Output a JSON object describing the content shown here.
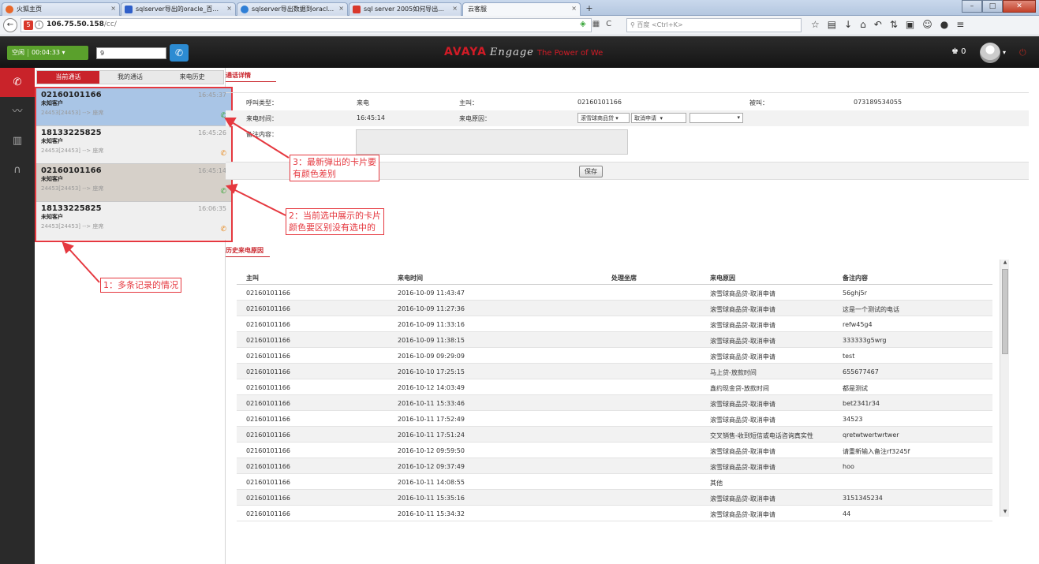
{
  "browser": {
    "tabs": [
      {
        "label": "火狐主页",
        "icon": "firefox-icon",
        "color": "#e8672a"
      },
      {
        "label": "sqlserver导出的oracle_百...",
        "icon": "baidu-paw-icon",
        "color": "#2f5fc9"
      },
      {
        "label": "sqlserver导出数据到oracl...",
        "icon": "baidu-search-icon",
        "color": "#2f7fd6"
      },
      {
        "label": "sql server 2005如何导出...",
        "icon": "document-icon",
        "color": "#d9382b"
      },
      {
        "label": "云客服",
        "icon": "",
        "color": ""
      }
    ],
    "new_tab": "+",
    "url_host": "106.75.50.158",
    "url_path": "/cc/",
    "search_placeholder": "百度 <Ctrl+K>"
  },
  "app": {
    "status_label": "空闲",
    "timer": "00:04:33",
    "dial_value": "9",
    "brand": "AVAYA",
    "brand_engage": "Engage",
    "brand_tagline": "The Power of We",
    "user_count": "0"
  },
  "call_tabs": [
    "当前通话",
    "我的通话",
    "来电历史"
  ],
  "cards": [
    {
      "number": "02160101166",
      "customer": "未知客户",
      "route": "24453[24453]  -->  座席",
      "time": "16:45:37",
      "icon_color": "#3aa63a"
    },
    {
      "number": "18133225825",
      "customer": "未知客户",
      "route": "24453[24453]  -->  座席",
      "time": "16:45:26",
      "icon_color": "#e8891d"
    },
    {
      "number": "02160101166",
      "customer": "未知客户",
      "route": "24453[24453]  -->  座席",
      "time": "16:45:14",
      "icon_color": "#3aa63a"
    },
    {
      "number": "18133225825",
      "customer": "未知客户",
      "route": "24453[24453]  -->  座席",
      "time": "16:06:35",
      "icon_color": "#e8891d"
    }
  ],
  "detail": {
    "title": "通话详情",
    "call_type_label": "呼叫类型：",
    "call_type_value": "来电",
    "caller_label": "主叫：",
    "caller_value": "02160101166",
    "callee_label": "被叫：",
    "callee_value": "073189534055",
    "time_label": "来电时间：",
    "time_value": "16:45:14",
    "reason_label": "来电原因：",
    "reason_select1": "滚雪球商品贷",
    "reason_select2": "取消申请",
    "reason_select3": "",
    "note_label": "备注内容：",
    "save_label": "保存"
  },
  "history": {
    "title": "历史来电原因",
    "columns": [
      "主叫",
      "来电时间",
      "处理坐席",
      "来电原因",
      "备注内容"
    ],
    "rows": [
      [
        "02160101166",
        "2016-10-09 11:43:47",
        "",
        "滚雪球商品贷-取消申请",
        "56ghj5r"
      ],
      [
        "02160101166",
        "2016-10-09 11:27:36",
        "",
        "滚雪球商品贷-取消申请",
        "这是一个测试的电话"
      ],
      [
        "02160101166",
        "2016-10-09 11:33:16",
        "",
        "滚雪球商品贷-取消申请",
        "refw45g4"
      ],
      [
        "02160101166",
        "2016-10-09 11:38:15",
        "",
        "滚雪球商品贷-取消申请",
        "333333g5wrg"
      ],
      [
        "02160101166",
        "2016-10-09 09:29:09",
        "",
        "滚雪球商品贷-取消申请",
        "test"
      ],
      [
        "02160101166",
        "2016-10-10 17:25:15",
        "",
        "马上贷-放款时间",
        "655677467"
      ],
      [
        "02160101166",
        "2016-10-12 14:03:49",
        "",
        "鑫约现金贷-放款时间",
        "都是测试"
      ],
      [
        "02160101166",
        "2016-10-11 15:33:46",
        "",
        "滚雪球商品贷-取消申请",
        "bet2341r34"
      ],
      [
        "02160101166",
        "2016-10-11 17:52:49",
        "",
        "滚雪球商品贷-取消申请",
        "34523"
      ],
      [
        "02160101166",
        "2016-10-11 17:51:24",
        "",
        "交叉销售-收到短信或电话咨询真实性",
        "qretwtwertwrtwer"
      ],
      [
        "02160101166",
        "2016-10-12 09:59:50",
        "",
        "滚雪球商品贷-取消申请",
        "请重新输入备注rf3245f"
      ],
      [
        "02160101166",
        "2016-10-12 09:37:49",
        "",
        "滚雪球商品贷-取消申请",
        "hoo"
      ],
      [
        "02160101166",
        "2016-10-11 14:08:55",
        "",
        "其他",
        ""
      ],
      [
        "02160101166",
        "2016-10-11 15:35:16",
        "",
        "滚雪球商品贷-取消申请",
        "3151345234"
      ],
      [
        "02160101166",
        "2016-10-11 15:34:32",
        "",
        "滚雪球商品贷-取消申请",
        "44"
      ]
    ]
  },
  "annotations": {
    "a1": "1：多条记录的情况",
    "a2_line1": "2：当前选中展示的卡片",
    "a2_line2": "颜色要区别没有选中的",
    "a3_line1": "3：最新弹出的卡片要",
    "a3_line2": "有颜色差别"
  },
  "colors": {
    "accent_red": "#c9232a",
    "annotation_red": "#e5383f",
    "selected_card": "#a9c5e6",
    "status_green": "#5aa02c"
  }
}
